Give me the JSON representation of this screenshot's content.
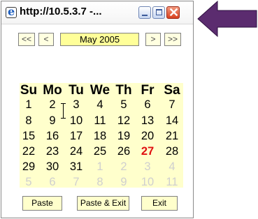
{
  "window": {
    "title": "http://10.5.3.7 -...",
    "icon": "ie-icon"
  },
  "window_controls": {
    "minimize": "minimize",
    "maximize": "maximize",
    "close": "✕"
  },
  "nav": {
    "prev_year": "<<",
    "prev_month": "<",
    "month_label": "May  2005",
    "next_month": ">",
    "next_year": ">>"
  },
  "weekdays": [
    "Su",
    "Mo",
    "Tu",
    "We",
    "Th",
    "Fr",
    "Sa"
  ],
  "weeks": [
    [
      {
        "d": "1",
        "s": "cur"
      },
      {
        "d": "2",
        "s": "cur"
      },
      {
        "d": "3",
        "s": "cur"
      },
      {
        "d": "4",
        "s": "cur"
      },
      {
        "d": "5",
        "s": "cur"
      },
      {
        "d": "6",
        "s": "cur"
      },
      {
        "d": "7",
        "s": "cur"
      }
    ],
    [
      {
        "d": "8",
        "s": "cur"
      },
      {
        "d": "9",
        "s": "cur"
      },
      {
        "d": "10",
        "s": "cur"
      },
      {
        "d": "11",
        "s": "cur"
      },
      {
        "d": "12",
        "s": "cur"
      },
      {
        "d": "13",
        "s": "cur"
      },
      {
        "d": "14",
        "s": "cur"
      }
    ],
    [
      {
        "d": "15",
        "s": "cur"
      },
      {
        "d": "16",
        "s": "cur"
      },
      {
        "d": "17",
        "s": "cur"
      },
      {
        "d": "18",
        "s": "cur"
      },
      {
        "d": "19",
        "s": "cur"
      },
      {
        "d": "20",
        "s": "cur"
      },
      {
        "d": "21",
        "s": "cur"
      }
    ],
    [
      {
        "d": "22",
        "s": "cur"
      },
      {
        "d": "23",
        "s": "cur"
      },
      {
        "d": "24",
        "s": "cur"
      },
      {
        "d": "25",
        "s": "cur"
      },
      {
        "d": "26",
        "s": "cur"
      },
      {
        "d": "27",
        "s": "today"
      },
      {
        "d": "28",
        "s": "cur"
      }
    ],
    [
      {
        "d": "29",
        "s": "cur"
      },
      {
        "d": "30",
        "s": "cur"
      },
      {
        "d": "31",
        "s": "cur"
      },
      {
        "d": "1",
        "s": "other"
      },
      {
        "d": "2",
        "s": "other"
      },
      {
        "d": "3",
        "s": "other"
      },
      {
        "d": "4",
        "s": "other"
      }
    ],
    [
      {
        "d": "5",
        "s": "other"
      },
      {
        "d": "6",
        "s": "other"
      },
      {
        "d": "7",
        "s": "other"
      },
      {
        "d": "8",
        "s": "other"
      },
      {
        "d": "9",
        "s": "other"
      },
      {
        "d": "10",
        "s": "other"
      },
      {
        "d": "11",
        "s": "other"
      }
    ]
  ],
  "actions": {
    "paste": "Paste",
    "paste_exit": "Paste & Exit",
    "exit": "Exit"
  },
  "colors": {
    "calendar_bg": "#ffffcc",
    "month_bg": "#ffff99",
    "today": "#e01010",
    "other_month": "#cfcfcf",
    "arrow": "#5b2c6f"
  },
  "icons": {
    "pointer_arrow": "left-arrow-icon",
    "mouse_cursor": "text-cursor-icon"
  }
}
